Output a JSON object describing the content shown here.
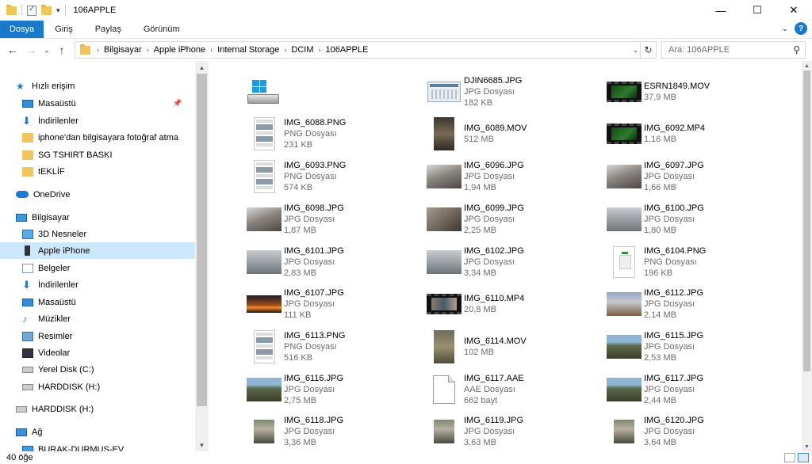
{
  "window": {
    "title": "106APPLE",
    "controls": [
      "—",
      "☐",
      "✕"
    ]
  },
  "ribbon": {
    "tabs": [
      "Dosya",
      "Giriş",
      "Paylaş",
      "Görünüm"
    ],
    "help": "?"
  },
  "address": {
    "crumbs": [
      "Bilgisayar",
      "Apple iPhone",
      "Internal Storage",
      "DCIM",
      "106APPLE"
    ]
  },
  "search": {
    "placeholder": "Ara: 106APPLE"
  },
  "nav": {
    "items": [
      {
        "label": "Hızlı erişim",
        "icon": "star-icon",
        "indent": 0
      },
      {
        "label": "Masaüstü",
        "icon": "desktop-icon",
        "indent": 1,
        "pinned": true
      },
      {
        "label": "İndirilenler",
        "icon": "download-icon",
        "indent": 1
      },
      {
        "label": "iphone'dan bilgisayara fotoğraf atma",
        "icon": "folder-icon",
        "indent": 1
      },
      {
        "label": "SG TSHIRT BASKI",
        "icon": "folder-icon",
        "indent": 1
      },
      {
        "label": "tEKLİF",
        "icon": "folder-icon",
        "indent": 1
      },
      {
        "label": "OneDrive",
        "icon": "cloud-icon",
        "indent": 0
      },
      {
        "label": "Bilgisayar",
        "icon": "computer-icon",
        "indent": 0
      },
      {
        "label": "3D Nesneler",
        "icon": "cube-icon",
        "indent": 1
      },
      {
        "label": "Apple iPhone",
        "icon": "phone-icon",
        "indent": 1,
        "selected": true
      },
      {
        "label": "Belgeler",
        "icon": "document-icon",
        "indent": 1
      },
      {
        "label": "İndirilenler",
        "icon": "download-icon",
        "indent": 1
      },
      {
        "label": "Masaüstü",
        "icon": "desktop-icon",
        "indent": 1
      },
      {
        "label": "Müzikler",
        "icon": "music-icon",
        "indent": 1
      },
      {
        "label": "Resimler",
        "icon": "picture-icon",
        "indent": 1
      },
      {
        "label": "Videolar",
        "icon": "video-icon",
        "indent": 1
      },
      {
        "label": "Yerel Disk (C:)",
        "icon": "disk-icon",
        "indent": 1
      },
      {
        "label": "HARDDISK (H:)",
        "icon": "disk-icon",
        "indent": 1
      },
      {
        "label": "HARDDISK (H:)",
        "icon": "disk-icon",
        "indent": 0
      },
      {
        "label": "Ağ",
        "icon": "network-icon",
        "indent": 0
      },
      {
        "label": "BURAK-DURMUS-EV",
        "icon": "computer-icon",
        "indent": 1
      }
    ]
  },
  "files": [
    {
      "name": "",
      "type": "",
      "size": "",
      "thumb": "drive"
    },
    {
      "name": "DJIN6685.JPG",
      "type": "JPG Dosyası",
      "size": "182 KB",
      "thumb": "scan"
    },
    {
      "name": "ESRN1849.MOV",
      "type": "",
      "size": "37,9 MB",
      "thumb": "film"
    },
    {
      "name": "IMG_6088.PNG",
      "type": "PNG Dosyası",
      "size": "231 KB",
      "thumb": "phone"
    },
    {
      "name": "IMG_6089.MOV",
      "type": "",
      "size": "512 MB",
      "thumb": "tall"
    },
    {
      "name": "IMG_6092.MP4",
      "type": "",
      "size": "1,16 MB",
      "thumb": "film"
    },
    {
      "name": "IMG_6093.PNG",
      "type": "PNG Dosyası",
      "size": "574 KB",
      "thumb": "phone"
    },
    {
      "name": "IMG_6096.JPG",
      "type": "JPG Dosyası",
      "size": "1,94 MB",
      "thumb": "land"
    },
    {
      "name": "IMG_6097.JPG",
      "type": "JPG Dosyası",
      "size": "1,66 MB",
      "thumb": "land"
    },
    {
      "name": "IMG_6098.JPG",
      "type": "JPG Dosyası",
      "size": "1,87 MB",
      "thumb": "land"
    },
    {
      "name": "IMG_6099.JPG",
      "type": "JPG Dosyası",
      "size": "2,25 MB",
      "thumb": "rock"
    },
    {
      "name": "IMG_6100.JPG",
      "type": "JPG Dosyası",
      "size": "1,80 MB",
      "thumb": "grey"
    },
    {
      "name": "IMG_6101.JPG",
      "type": "JPG Dosyası",
      "size": "2,83 MB",
      "thumb": "grey"
    },
    {
      "name": "IMG_6102.JPG",
      "type": "JPG Dosyası",
      "size": "3,34 MB",
      "thumb": "grey"
    },
    {
      "name": "IMG_6104.PNG",
      "type": "PNG Dosyası",
      "size": "196 KB",
      "thumb": "card"
    },
    {
      "name": "IMG_6107.JPG",
      "type": "JPG Dosyası",
      "size": "111 KB",
      "thumb": "sun"
    },
    {
      "name": "IMG_6110.MP4",
      "type": "",
      "size": "20,8 MB",
      "thumb": "filmmix"
    },
    {
      "name": "IMG_6112.JPG",
      "type": "JPG Dosyası",
      "size": "2,14 MB",
      "thumb": "town"
    },
    {
      "name": "IMG_6113.PNG",
      "type": "PNG Dosyası",
      "size": "516 KB",
      "thumb": "phone"
    },
    {
      "name": "IMG_6114.MOV",
      "type": "",
      "size": "102 MB",
      "thumb": "tall2"
    },
    {
      "name": "IMG_6115.JPG",
      "type": "JPG Dosyası",
      "size": "2,53 MB",
      "thumb": "hill"
    },
    {
      "name": "IMG_6116.JPG",
      "type": "JPG Dosyası",
      "size": "2,75 MB",
      "thumb": "hill"
    },
    {
      "name": "IMG_6117.AAE",
      "type": "AAE Dosyası",
      "size": "662 bayt",
      "thumb": "file"
    },
    {
      "name": "IMG_6117.JPG",
      "type": "JPG Dosyası",
      "size": "2,44 MB",
      "thumb": "hill"
    },
    {
      "name": "IMG_6118.JPG",
      "type": "JPG Dosyası",
      "size": "3,36 MB",
      "thumb": "people"
    },
    {
      "name": "IMG_6119.JPG",
      "type": "JPG Dosyası",
      "size": "3,63 MB",
      "thumb": "people"
    },
    {
      "name": "IMG_6120.JPG",
      "type": "JPG Dosyası",
      "size": "3,64 MB",
      "thumb": "people"
    }
  ],
  "status": {
    "count": "40 öğe"
  },
  "colors": {
    "accent": "#1979ca",
    "selection": "#cce8ff",
    "secondary_text": "#6d6d6d"
  }
}
